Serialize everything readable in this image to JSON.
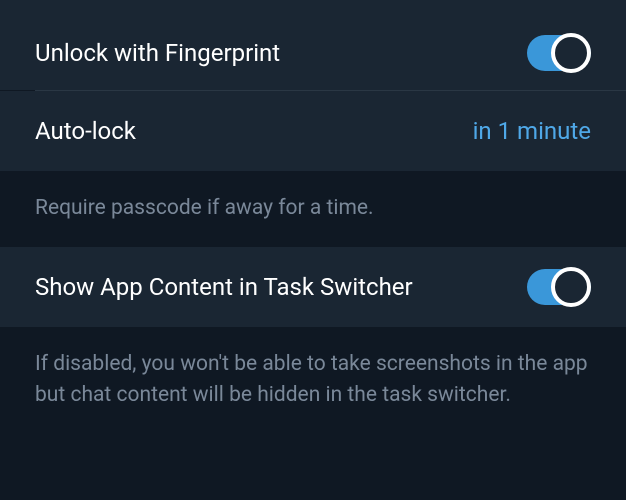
{
  "settings": {
    "fingerprint": {
      "label": "Unlock with Fingerprint",
      "enabled": true
    },
    "autolock": {
      "label": "Auto-lock",
      "value": "in 1 minute",
      "description": "Require passcode if away for a time."
    },
    "taskSwitcher": {
      "label": "Show App Content in Task Switcher",
      "enabled": true,
      "description": "If disabled, you won't be able to take screenshots in the app but chat content will be hidden in the task switcher."
    }
  }
}
